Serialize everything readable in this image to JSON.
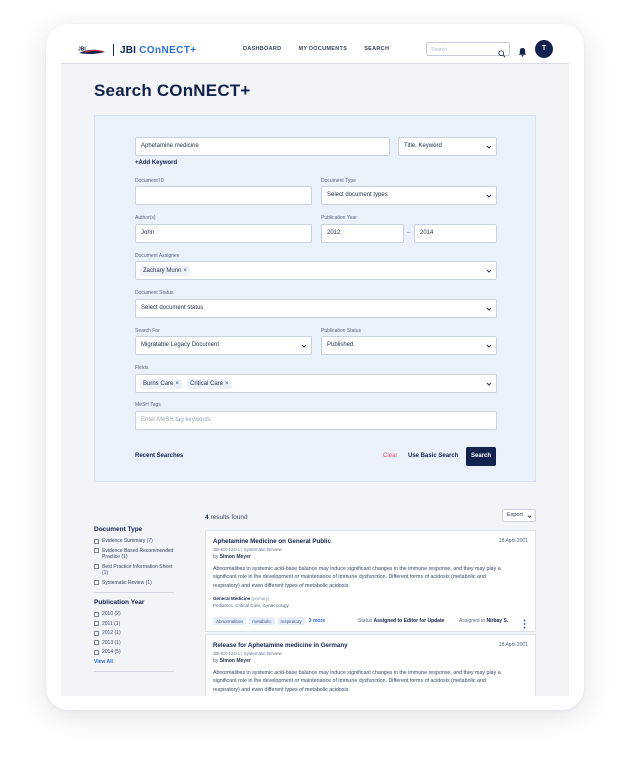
{
  "app": {
    "logo_text": "JBI",
    "brand": "JBI",
    "brand_suffix": "COnNECT+"
  },
  "nav": {
    "links": [
      "DASHBOARD",
      "MY DOCUMENTS",
      "SEARCH"
    ],
    "search_placeholder": "Search",
    "avatar_initial": "T"
  },
  "page": {
    "title": "Search COnNECT+"
  },
  "form": {
    "keyword_value": "Aphetamine medicine",
    "keyword_field": "Title, Keyword",
    "add_keyword": "+Add Keyword",
    "document_id_label": "Document ID",
    "document_id_value": "",
    "document_type_label": "Document Type",
    "document_type_value": "Select document types",
    "authors_label": "Author(s)",
    "authors_value": "John",
    "pub_year_label": "Publication Year",
    "pub_year_from": "2012",
    "pub_year_dash": "–",
    "pub_year_to": "2014",
    "assignee_label": "Document Assignee",
    "assignee_chips": [
      "Zachary Munn"
    ],
    "status_label": "Document Status",
    "status_value": "Select document status",
    "search_for_label": "Search For",
    "search_for_value": "Migratable Legacy Document",
    "pub_status_label": "Publication Status",
    "pub_status_value": "Published",
    "fields_label": "Fields",
    "fields_chips": [
      "Burns Care",
      "Critical Care"
    ],
    "mesh_label": "MeSH Tags",
    "mesh_placeholder": "Enter MeSH tag keywords",
    "recent_searches": "Recent Searches",
    "clear": "Clear",
    "basic_search": "Use Basic Search",
    "search_button": "Search"
  },
  "filters": {
    "doc_type_heading": "Document Type",
    "doc_types": [
      "Evidence Summary (7)",
      "Evidence Based Recommended Practice (1)",
      "Best Practice Information Sheet (1)",
      "Systematic Review (1)"
    ],
    "pub_year_heading": "Publication Year",
    "pub_years": [
      "2010 (2)",
      "2011 (1)",
      "2012 (1)",
      "2013 (1)",
      "2014 (5)"
    ],
    "view_all": "View All"
  },
  "results": {
    "count": "4",
    "count_suffix": "results found",
    "export_label": "Export",
    "items": [
      {
        "title": "Aphetamine Medicine on General Public",
        "date": "18 April 2001",
        "meta": "JBI-ES-121-1  |  Systematic Review",
        "by_prefix": "by",
        "author": "Simon Meyer",
        "description": "Abnormalities in systemic acid-base balance may induce significant changes in the immune response, and they may play a significant role in the development or maintenance of immune dysfunction. Different forms of acidosis (metabolic and respiratory) and even different types of metabolic acidosis.",
        "category": "General Medicine",
        "category_tag": "(primary)",
        "subcategories": "Pediatrics, Critical Care, Gynaecology",
        "tags": [
          "Abnormalities",
          "metabolic",
          "respiratory"
        ],
        "more": "3 more",
        "status_prefix": "Status",
        "status": "Assigned to Editor for Update",
        "assigned_prefix": "Assigned to",
        "assignee": "Nirbay S."
      },
      {
        "title": "Release for Aphetamine medicine in Germany",
        "date": "18 April 2001",
        "meta": "JBI-ES-121-1  |  Systematic Review",
        "by_prefix": "by",
        "author": "Simon Meyer",
        "description": "Abnormalities in systemic acid-base balance may induce significant changes in the immune response, and they may play a significant role in the development or maintenance of immune dysfunction. Different forms of acidosis (metabolic and respiratory) and even different types of metabolic acidosis."
      }
    ]
  },
  "colors": {
    "primary": "#13224d",
    "accent": "#2c6edb",
    "form_bg": "#eaf1fb",
    "clear": "#e0566b"
  }
}
